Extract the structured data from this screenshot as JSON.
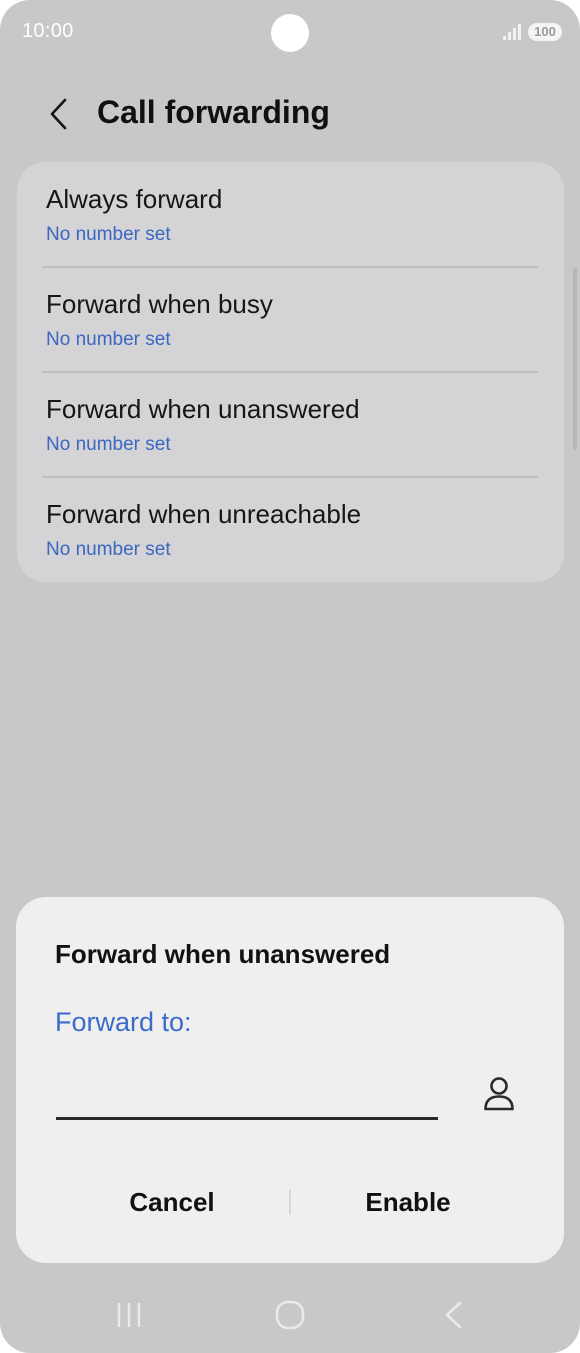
{
  "status_bar": {
    "time": "10:00",
    "battery": "100"
  },
  "header": {
    "title": "Call forwarding",
    "back_icon": "chevron-left-icon"
  },
  "list": {
    "items": [
      {
        "title": "Always forward",
        "subtitle": "No number set"
      },
      {
        "title": "Forward when busy",
        "subtitle": "No number set"
      },
      {
        "title": "Forward when unanswered",
        "subtitle": "No number set"
      },
      {
        "title": "Forward when unreachable",
        "subtitle": "No number set"
      }
    ]
  },
  "dialog": {
    "title": "Forward when unanswered",
    "label": "Forward to:",
    "input_value": "",
    "contact_icon": "person-icon",
    "cancel_label": "Cancel",
    "enable_label": "Enable"
  },
  "nav_bar": {
    "icons": [
      "recent-apps-icon",
      "home-icon",
      "back-icon"
    ]
  },
  "colors": {
    "background_dim": "#c8c8c9",
    "card": "#d4d4d6",
    "dialog": "#efefef",
    "accent_blue": "#3b67c3"
  }
}
